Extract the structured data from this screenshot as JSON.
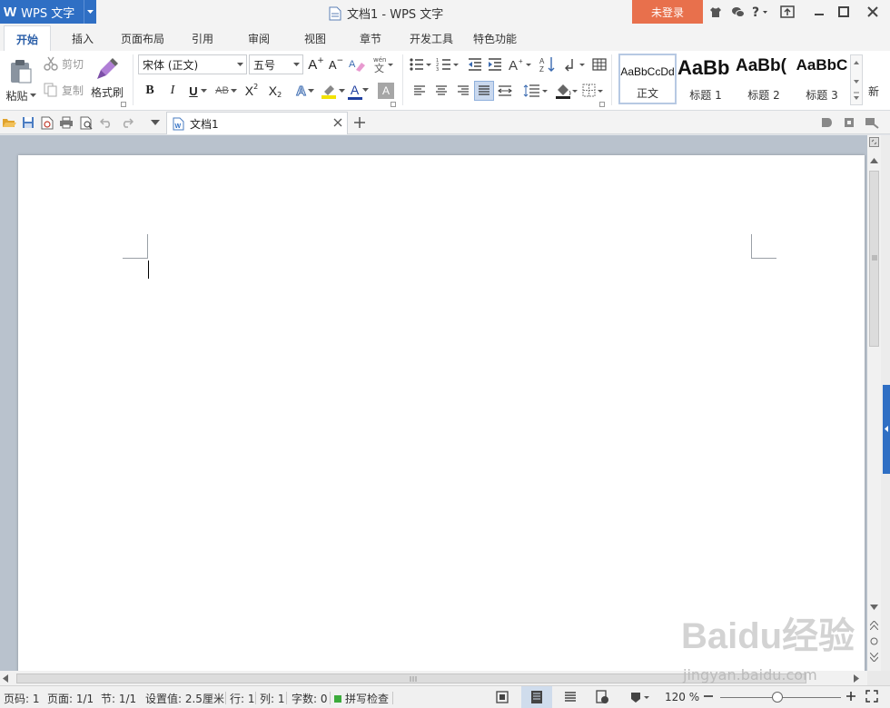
{
  "app": {
    "logo": "W",
    "name": "WPS 文字"
  },
  "window": {
    "title": "文档1 - WPS 文字",
    "login_label": "未登录"
  },
  "ribbon_tabs": [
    "开始",
    "插入",
    "页面布局",
    "引用",
    "审阅",
    "视图",
    "章节",
    "开发工具",
    "特色功能"
  ],
  "clipboard": {
    "paste": "粘贴",
    "cut": "剪切",
    "copy": "复制",
    "format_painter": "格式刷"
  },
  "font": {
    "family": "宋体 (正文)",
    "size": "五号"
  },
  "format_buttons": {
    "bold": "B",
    "italic": "I",
    "underline": "U",
    "strikethrough": "AB",
    "superscript": "X",
    "subscript": "X",
    "text_effect": "A",
    "font_color": "A",
    "char_shading": "A",
    "grow": "A",
    "shrink": "A"
  },
  "styles": [
    {
      "preview": "AaBbCcDd",
      "label": "正文"
    },
    {
      "preview": "AaBb",
      "label": "标题 1"
    },
    {
      "preview": "AaBb(",
      "label": "标题 2"
    },
    {
      "preview": "AaBbC",
      "label": "标题 3"
    }
  ],
  "styles_more": "新",
  "document_tab": {
    "name": "文档1"
  },
  "status": {
    "page_no": "页码: 1",
    "pages": "页面: 1/1",
    "section": "节: 1/1",
    "setting": "设置值: 2.5厘米",
    "line": "行: 1",
    "column": "列: 1",
    "word_count": "字数: 0",
    "spell_check": "拼写检查",
    "zoom": "120 %",
    "zoom_level": 0.47
  },
  "watermark": {
    "brand": "Baidu经验",
    "url": "jingyan.baidu.com"
  },
  "colors": {
    "accent": "#2f6fc4",
    "login": "#e8704c",
    "active_tab_text": "#2a5ea8",
    "workspace": "#b9c2cd"
  }
}
